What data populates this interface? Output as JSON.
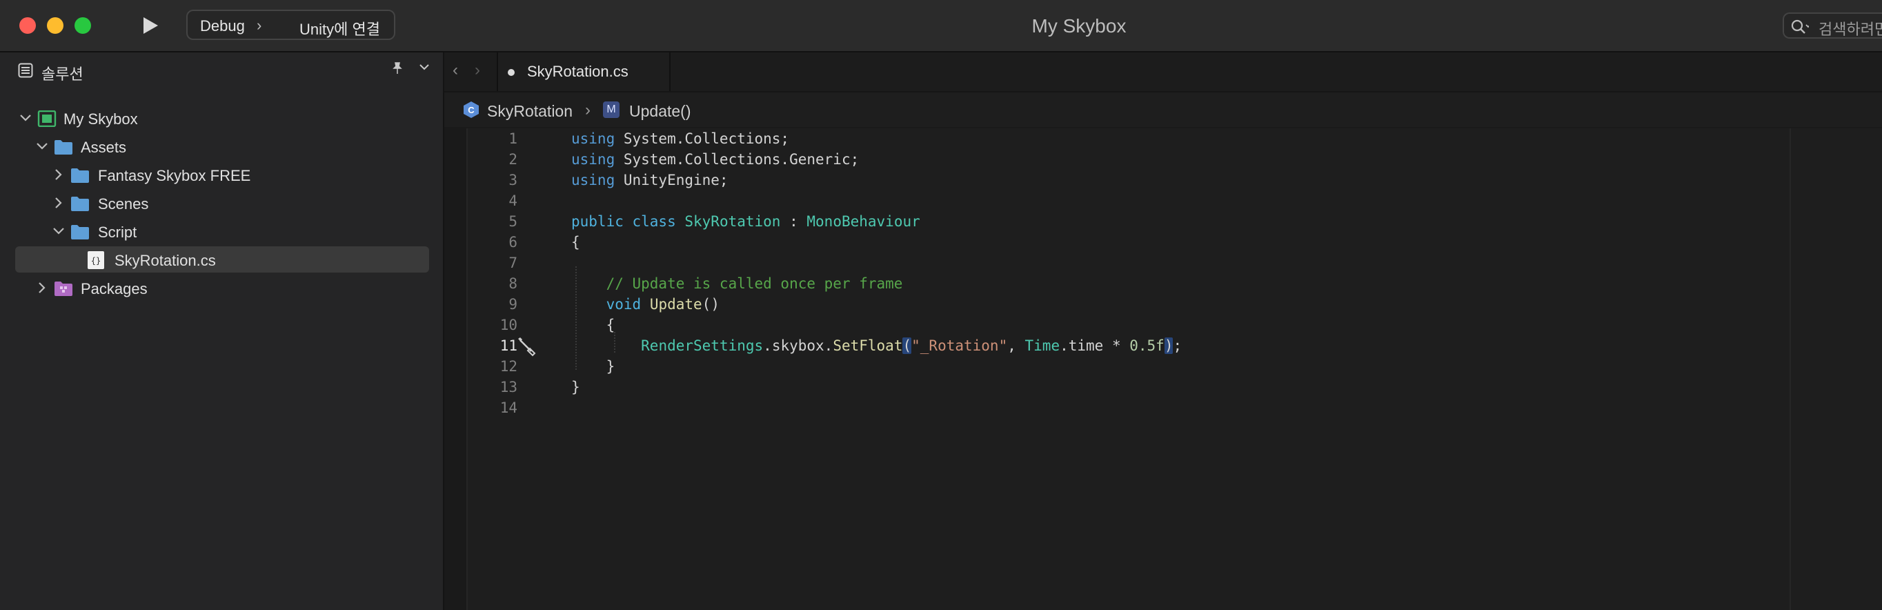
{
  "window": {
    "title": "My Skybox"
  },
  "toolbar": {
    "run_icon": "play-icon",
    "config": "Debug",
    "config_chevron": "›",
    "target": "Unity에 연결",
    "search_placeholder": "검색하려면"
  },
  "sidebar": {
    "title": "솔루션",
    "pin_glyph": "📌",
    "collapse_glyph": "⌄",
    "tree": [
      {
        "label": "My Skybox",
        "icon": "solution-icon",
        "expanded": true,
        "depth": 0
      },
      {
        "label": "Assets",
        "icon": "folder-icon",
        "expanded": true,
        "depth": 1
      },
      {
        "label": "Fantasy Skybox FREE",
        "icon": "folder-icon",
        "expanded": false,
        "depth": 2
      },
      {
        "label": "Scenes",
        "icon": "folder-icon",
        "expanded": false,
        "depth": 2
      },
      {
        "label": "Script",
        "icon": "folder-icon",
        "expanded": true,
        "depth": 2
      },
      {
        "label": "SkyRotation.cs",
        "icon": "csharp-file-icon",
        "selected": true,
        "depth": 3
      },
      {
        "label": "Packages",
        "icon": "packages-folder-icon",
        "expanded": false,
        "depth": 1
      }
    ]
  },
  "editor": {
    "nav_back": "‹",
    "nav_forward": "›",
    "tab_label": "SkyRotation.cs",
    "breadcrumb": {
      "class_name": "SkyRotation",
      "separator": "›",
      "method_badge": "M",
      "method_name": "Update()"
    },
    "current_line": 11,
    "line_numbers": [
      "1",
      "2",
      "3",
      "4",
      "5",
      "6",
      "7",
      "8",
      "9",
      "10",
      "11",
      "12",
      "13",
      "14"
    ],
    "code": [
      {
        "t1": "using",
        "t2": " System.Collections;"
      },
      {
        "t1": "using",
        "t2": " System.Collections.Generic;"
      },
      {
        "t1": "using",
        "t2": " UnityEngine;"
      },
      {},
      {
        "t1": "public class",
        "t2": " ",
        "t3": "SkyRotation",
        "t4": " : ",
        "t5": "MonoBehaviour"
      },
      {
        "t1": "{"
      },
      {},
      {
        "t1": "    // Update is called once per frame"
      },
      {
        "t1": "    ",
        "t2": "void",
        "t3": " ",
        "t4": "Update",
        "t5": "()"
      },
      {
        "t1": "    {"
      },
      {
        "t1": "        ",
        "t2": "RenderSettings",
        "t3": ".skybox.",
        "t4": "SetFloat",
        "t5": "(",
        "t6": "\"_Rotation\"",
        "t7": ", ",
        "t8": "Time",
        "t9": ".time * ",
        "t10": "0.5f",
        "t11": ")",
        "t12": ";"
      },
      {
        "t1": "    }"
      },
      {
        "t1": "}"
      },
      {}
    ]
  }
}
